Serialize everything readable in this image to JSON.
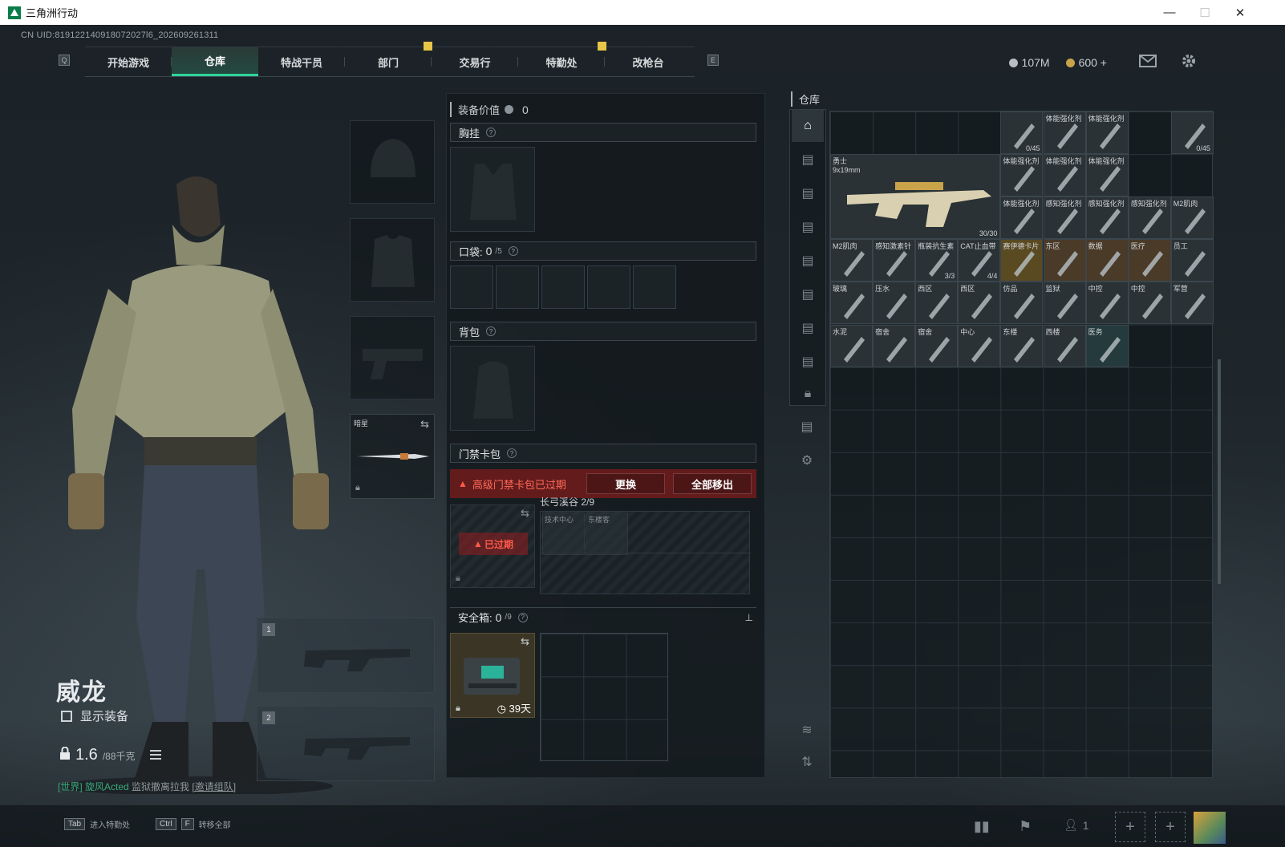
{
  "window": {
    "title": "三角洲行动",
    "min": "—",
    "max": "☐",
    "close": "✕"
  },
  "uid": "CN UID:819122140918072027l6_202609261311",
  "nav": {
    "key_left": "Q",
    "key_right": "E",
    "tabs": [
      "开始游戏",
      "仓库",
      "特战干员",
      "部门",
      "交易行",
      "特勤处",
      "改枪台"
    ],
    "active": "仓库"
  },
  "currency": {
    "silver": "107M",
    "gold": "600 +"
  },
  "character": {
    "name": "威龙",
    "show_equip": "显示装备",
    "weight": "1.6",
    "weight_max": "/88千克"
  },
  "chat": {
    "prefix": "[世界]",
    "sender": "旋风Acted",
    "message": "监狱撤离拉我",
    "link": "[邀请组队]"
  },
  "weapons": {
    "melee_label": "暗星",
    "slot1": "1",
    "slot2": "2"
  },
  "equip_panel": {
    "value_label": "装备价值",
    "value": "0",
    "chest": "胸挂",
    "pocket": "口袋:",
    "pocket_count": "0",
    "pocket_max": "/5",
    "backpack": "背包",
    "keycard": "门禁卡包",
    "expired_warning": "高级门禁卡包已过期",
    "replace": "更换",
    "remove_all": "全部移出",
    "map": "长弓溪谷",
    "map_count": "2/9",
    "expired_tag": "已过期",
    "card_a": "技术中心",
    "card_b": "东楼客",
    "safebox": "安全箱:",
    "safebox_count": "0",
    "safebox_max": "/9",
    "safebox_days": "39天"
  },
  "warehouse": {
    "title": "仓库",
    "items": [
      {
        "name": "",
        "count": "0/45"
      },
      {
        "name": "体能强化剂",
        "count": ""
      },
      {
        "name": "体能强化剂",
        "count": ""
      },
      {
        "name": "",
        "count": "0/45"
      },
      {
        "name": "勇士\n9x19mm",
        "count": "30/30"
      },
      {
        "name": "体能强化剂",
        "count": ""
      },
      {
        "name": "体能强化剂",
        "count": ""
      },
      {
        "name": "体能强化剂",
        "count": ""
      },
      {
        "name": "体能强化剂",
        "count": ""
      },
      {
        "name": "感知强化剂",
        "count": ""
      },
      {
        "name": "感知强化剂",
        "count": ""
      },
      {
        "name": "感知强化剂",
        "count": ""
      },
      {
        "name": "M2肌肉",
        "count": ""
      },
      {
        "name": "M2肌肉",
        "count": ""
      },
      {
        "name": "感知激素针",
        "count": ""
      },
      {
        "name": "瓶装抗生素",
        "count": "3/3"
      },
      {
        "name": "CAT止血带",
        "count": "4/4"
      },
      {
        "name": "赛伊德卡片",
        "count": ""
      },
      {
        "name": "东区",
        "count": ""
      },
      {
        "name": "数据",
        "count": ""
      },
      {
        "name": "医疗",
        "count": ""
      },
      {
        "name": "员工",
        "count": ""
      },
      {
        "name": "玻璃",
        "count": ""
      },
      {
        "name": "压水",
        "count": ""
      },
      {
        "name": "西区",
        "count": ""
      },
      {
        "name": "西区",
        "count": ""
      },
      {
        "name": "仿品",
        "count": ""
      },
      {
        "name": "监狱",
        "count": ""
      },
      {
        "name": "中控",
        "count": ""
      },
      {
        "name": "中控",
        "count": ""
      },
      {
        "name": "军营",
        "count": ""
      },
      {
        "name": "水泥",
        "count": ""
      },
      {
        "name": "宿舍",
        "count": ""
      },
      {
        "name": "宿舍",
        "count": ""
      },
      {
        "name": "中心",
        "count": ""
      },
      {
        "name": "东楼",
        "count": ""
      },
      {
        "name": "西楼",
        "count": ""
      },
      {
        "name": "医务",
        "count": ""
      }
    ]
  },
  "bottom": {
    "tab_key": "Tab",
    "tab_label": "进入特勤处",
    "ctrl_key": "Ctrl",
    "f_key": "F",
    "ctrl_label": "转移全部",
    "friends": "1"
  },
  "colors": {
    "accent": "#2fd49a",
    "warning": "#e14a3c",
    "highlight": "#e8c547"
  }
}
